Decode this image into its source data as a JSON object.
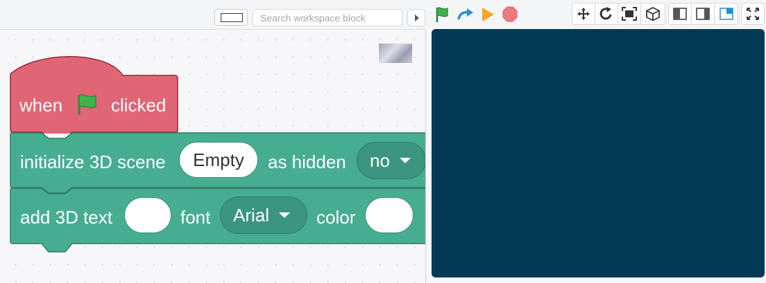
{
  "workspace_toolbar": {
    "search_placeholder": "Search workspace block"
  },
  "run_controls": {
    "green_flag": "green-flag-icon",
    "redo": "redo-arrow-icon",
    "play": "play-icon",
    "stop": "stop-icon"
  },
  "stage_controls": {
    "move": "move-icon",
    "rotate": "rotate-icon",
    "fit": "fit-screen-icon",
    "cube": "cube-icon",
    "layout_left": "layout-left-icon",
    "layout_right": "layout-right-icon",
    "layout_small": "layout-small-stage-icon",
    "fullscreen": "fullscreen-icon"
  },
  "blocks": {
    "hat": {
      "when": "when",
      "clicked": "clicked"
    },
    "init_scene": {
      "label": "initialize 3D scene",
      "scene_value": "Empty",
      "as_hidden": "as hidden",
      "hidden_value": "no"
    },
    "add_text": {
      "label": "add 3D text",
      "font": "font",
      "font_value": "Arial",
      "color": "color"
    }
  },
  "colors": {
    "hat_block": "#e06575",
    "teal_block": "#47ad91",
    "stage_bg": "#023a55",
    "flag_green": "#3cb449",
    "play_orange": "#f5a623",
    "stop_red": "#ec7b7e"
  }
}
